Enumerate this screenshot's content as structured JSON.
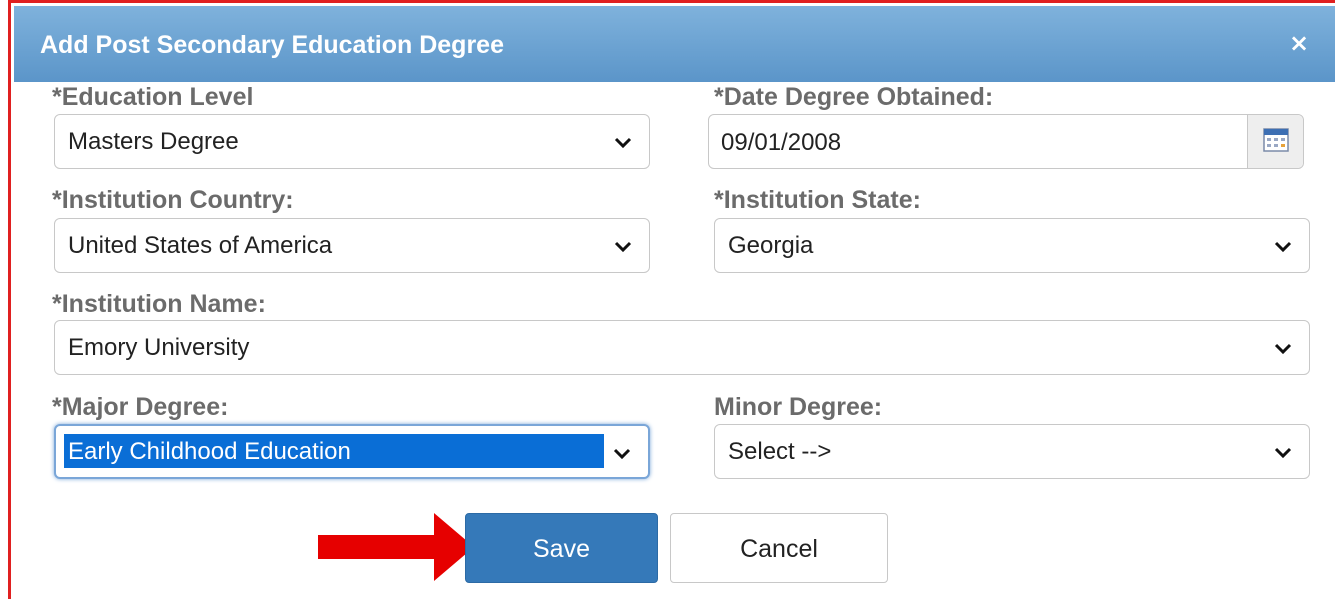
{
  "dialog": {
    "title": "Add Post Secondary Education Degree",
    "close_glyph": "×"
  },
  "fields": {
    "education_level": {
      "label": "*Education Level",
      "value": "Masters Degree"
    },
    "date_obtained": {
      "label": "*Date Degree Obtained:",
      "value": "09/01/2008",
      "icon": "calendar-icon"
    },
    "institution_country": {
      "label": "*Institution Country:",
      "value": "United States of America"
    },
    "institution_state": {
      "label": "*Institution State:",
      "value": "Georgia"
    },
    "institution_name": {
      "label": "*Institution Name:",
      "value": "Emory University"
    },
    "major_degree": {
      "label": "*Major Degree:",
      "value": "Early Childhood Education"
    },
    "minor_degree": {
      "label": "Minor Degree:",
      "value": "Select -->"
    }
  },
  "buttons": {
    "save_label": "Save",
    "cancel_label": "Cancel"
  },
  "annotation": {
    "arrow_color": "#e60000"
  },
  "colors": {
    "title_bar": "#6aa2d3",
    "save_button": "#3579b9",
    "selection_highlight": "#0a6ed6",
    "frame_border": "#e02020"
  }
}
